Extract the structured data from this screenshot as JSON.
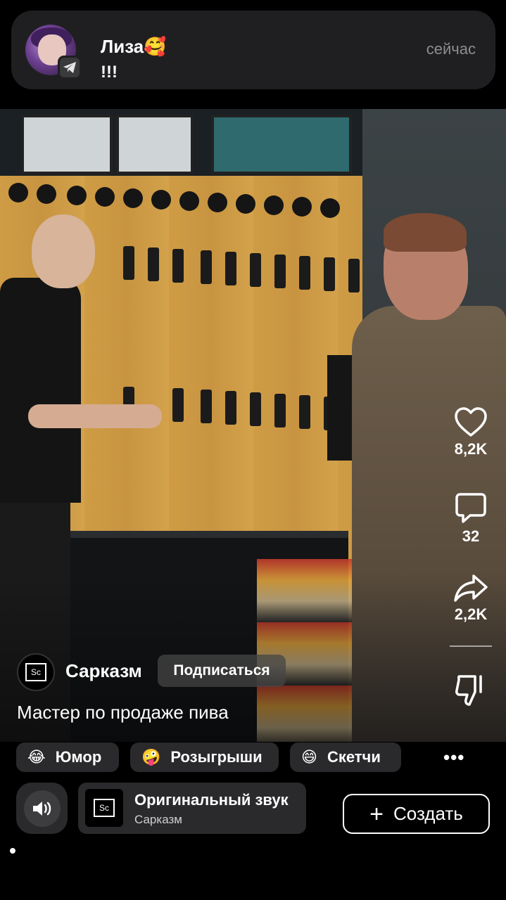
{
  "notification": {
    "sender": "Лиза🥰",
    "message": "!!!",
    "time": "сейчас",
    "app_icon": "telegram-icon"
  },
  "video": {
    "channel": {
      "name": "Сарказм",
      "avatar_text": "Sc",
      "subscribe_label": "Подписаться"
    },
    "caption": "Мастер по продаже пива"
  },
  "actions": {
    "likes": "8,2K",
    "comments": "32",
    "shares": "2,2K",
    "icons": [
      "heart-icon",
      "comment-icon",
      "share-icon",
      "dislike-icon"
    ]
  },
  "tags": [
    {
      "emoji": "😂",
      "label": "Юмор"
    },
    {
      "emoji": "🤪",
      "label": "Розыгрыши"
    },
    {
      "emoji": "😄",
      "label": "Скетчи"
    }
  ],
  "more_label": "•••",
  "audio": {
    "title": "Оригинальный звук",
    "subtitle": "Сарказм",
    "thumb_text": "Sc"
  },
  "create_label": "Создать"
}
